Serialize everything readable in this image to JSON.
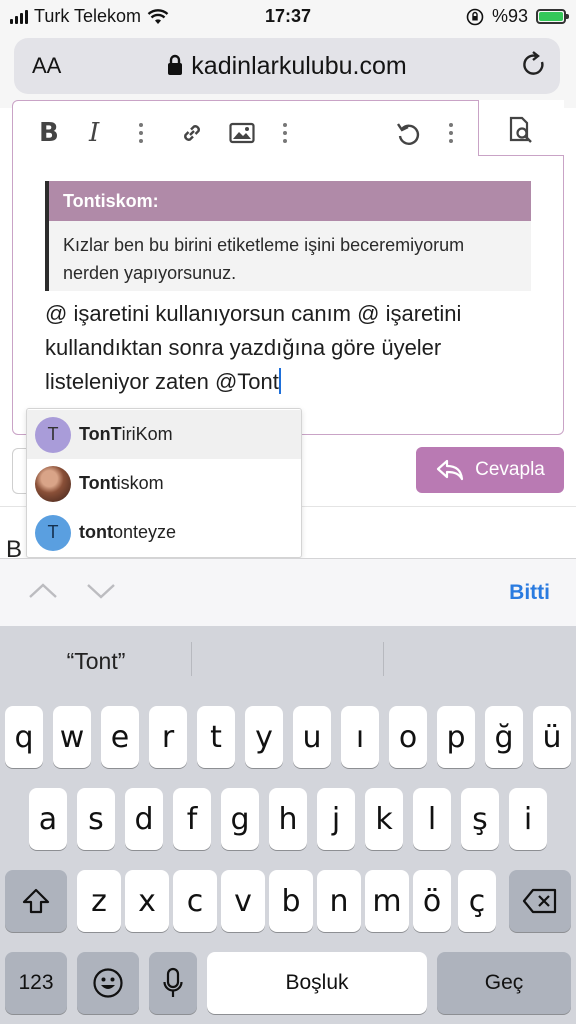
{
  "status": {
    "carrier": "Turk Telekom",
    "time": "17:37",
    "battery": "%93"
  },
  "browser": {
    "aa_label": "AA",
    "url": "kadinlarkulubu.com"
  },
  "editor": {
    "quote_author": "Tontiskom:",
    "quote_lines": [
      "Kızlar ben bu birini etiketleme işini beceremiyorum",
      "nerden yapıyorsunuz."
    ],
    "compose_lines": [
      "@ işaretini kullanıyorsun canım @ işaretini",
      "kullandıktan sonra yazdığına göre üyeler",
      "listeleniyor zaten @Tont"
    ]
  },
  "reply_button": {
    "label": "Cevapla"
  },
  "partial_text": "B",
  "mentions": [
    {
      "avatar_letter": "T",
      "match": "TonT",
      "rest": "iriKom",
      "avatar_color": "#a99cd9"
    },
    {
      "avatar_letter": "",
      "match": "Tont",
      "rest": "iskom",
      "avatar_color": "#7a4a36"
    },
    {
      "avatar_letter": "T",
      "match": "tont",
      "rest": "onteyze",
      "avatar_color": "#5a9fe0"
    }
  ],
  "accessory": {
    "done_label": "Bitti"
  },
  "keyboard": {
    "suggestion": "“Tont”",
    "row1": [
      "q",
      "w",
      "e",
      "r",
      "t",
      "y",
      "u",
      "ı",
      "o",
      "p",
      "ğ",
      "ü"
    ],
    "row2": [
      "a",
      "s",
      "d",
      "f",
      "g",
      "h",
      "j",
      "k",
      "l",
      "ş",
      "i"
    ],
    "row3": [
      "z",
      "x",
      "c",
      "v",
      "b",
      "n",
      "m",
      "ö",
      "ç"
    ],
    "numbers_label": "123",
    "space_label": "Boşluk",
    "return_label": "Geç"
  },
  "colors": {
    "accent": "#b97ab3",
    "quote_header": "#b08aa8",
    "done": "#2a7be0"
  }
}
